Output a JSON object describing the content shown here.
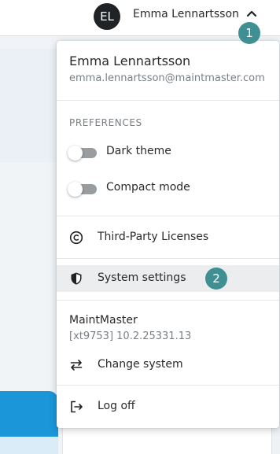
{
  "header": {
    "avatar_initials": "EL",
    "user_name": "Emma Lennartsson",
    "menu_toggle_icon": "chevron-up-icon"
  },
  "menu": {
    "user": {
      "name": "Emma Lennartsson",
      "email": "emma.lennartsson@maintmaster.com"
    },
    "preferences": {
      "heading": "PREFERENCES",
      "toggles": [
        {
          "label": "Dark theme",
          "on": false
        },
        {
          "label": "Compact mode",
          "on": false
        }
      ]
    },
    "items": {
      "licenses": {
        "label": "Third-Party Licenses",
        "icon": "copyright-icon"
      },
      "system_settings": {
        "label": "System settings",
        "icon": "shield-icon",
        "selected": true
      }
    },
    "system": {
      "name": "MaintMaster",
      "version": "[xt9753] 10.2.25331.13",
      "change_label": "Change system",
      "change_icon": "swap-arrows-icon"
    },
    "logoff": {
      "label": "Log off",
      "icon": "logout-icon"
    }
  },
  "annotations": {
    "step1": "1",
    "step2": "2",
    "color": "#3f8f93"
  },
  "colors": {
    "accent_blue": "#1a96d9",
    "avatar_bg": "#1f2326",
    "selected_bg": "#ebedef"
  }
}
